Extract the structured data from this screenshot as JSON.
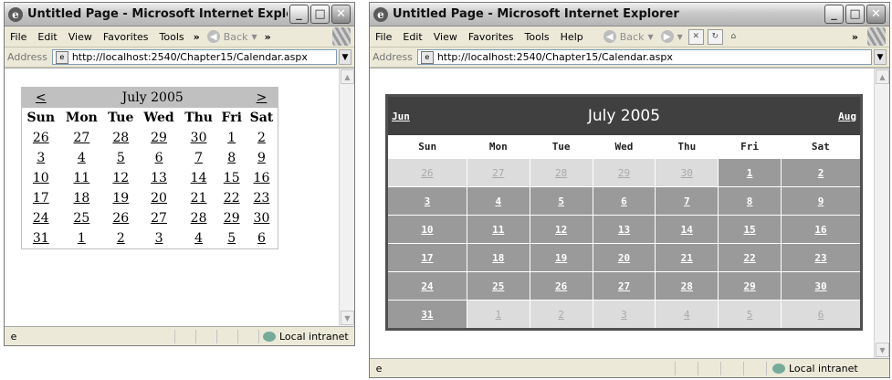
{
  "window1": {
    "title": "Untitled Page - Microsoft Internet Explorer",
    "menu": [
      "File",
      "Edit",
      "View",
      "Favorites",
      "Tools"
    ],
    "overflow": "»",
    "back": "Back",
    "address_label": "Address",
    "url": "http://localhost:2540/Chapter15/Calendar.aspx",
    "status": "Local intranet",
    "calendar": {
      "prev": "<",
      "next": ">",
      "month": "July 2005",
      "days": [
        "Sun",
        "Mon",
        "Tue",
        "Wed",
        "Thu",
        "Fri",
        "Sat"
      ],
      "weeks": [
        [
          "26",
          "27",
          "28",
          "29",
          "30",
          "1",
          "2"
        ],
        [
          "3",
          "4",
          "5",
          "6",
          "7",
          "8",
          "9"
        ],
        [
          "10",
          "11",
          "12",
          "13",
          "14",
          "15",
          "16"
        ],
        [
          "17",
          "18",
          "19",
          "20",
          "21",
          "22",
          "23"
        ],
        [
          "24",
          "25",
          "26",
          "27",
          "28",
          "29",
          "30"
        ],
        [
          "31",
          "1",
          "2",
          "3",
          "4",
          "5",
          "6"
        ]
      ]
    }
  },
  "window2": {
    "title": "Untitled Page - Microsoft Internet Explorer",
    "menu": [
      "File",
      "Edit",
      "View",
      "Favorites",
      "Tools",
      "Help"
    ],
    "overflow": "»",
    "back": "Back",
    "address_label": "Address",
    "url": "http://localhost:2540/Chapter15/Calendar.aspx",
    "status": "Local intranet",
    "calendar": {
      "prev": "Jun",
      "next": "Aug",
      "month": "July 2005",
      "days": [
        "Sun",
        "Mon",
        "Tue",
        "Wed",
        "Thu",
        "Fri",
        "Sat"
      ],
      "weeks": [
        [
          "26",
          "27",
          "28",
          "29",
          "30",
          "1",
          "2"
        ],
        [
          "3",
          "4",
          "5",
          "6",
          "7",
          "8",
          "9"
        ],
        [
          "10",
          "11",
          "12",
          "13",
          "14",
          "15",
          "16"
        ],
        [
          "17",
          "18",
          "19",
          "20",
          "21",
          "22",
          "23"
        ],
        [
          "24",
          "25",
          "26",
          "27",
          "28",
          "29",
          "30"
        ],
        [
          "31",
          "1",
          "2",
          "3",
          "4",
          "5",
          "6"
        ]
      ],
      "colors": {
        "current_month": "#9a9a9a",
        "other_month": "#dcdcdc",
        "header": "#404040"
      }
    }
  }
}
